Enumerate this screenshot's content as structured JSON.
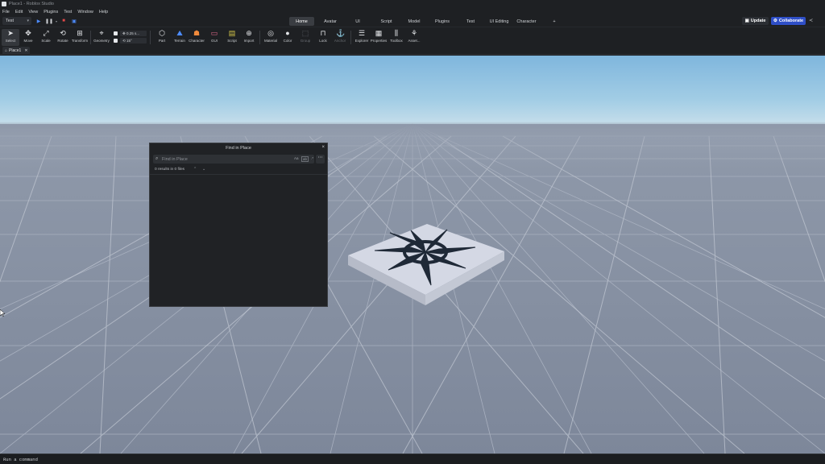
{
  "window": {
    "title": "Place1 - Roblox Studio"
  },
  "menu": [
    "File",
    "Edit",
    "View",
    "Plugins",
    "Test",
    "Window",
    "Help"
  ],
  "mode_select": {
    "value": "Test"
  },
  "ribbon_tabs": [
    "Home",
    "Avatar",
    "UI",
    "Script",
    "Model",
    "Plugins",
    "Test",
    "UI Editing",
    "Character",
    "+"
  ],
  "header_buttons": {
    "update": "Update",
    "collaborate": "Collaborate"
  },
  "tools": {
    "select": "Select",
    "move": "Move",
    "scale": "Scale",
    "rotate": "Rotate",
    "transform": "Transform",
    "geometry": "Geometry",
    "move_snap": "0.25 s...",
    "rotate_snap": "15°",
    "part": "Part",
    "terrain": "Terrain",
    "character": "Character",
    "gui": "GUI",
    "script": "Script",
    "import": "Import",
    "material": "Material",
    "color": "Color",
    "group": "Group",
    "lock": "Lock",
    "anchor": "Anchor",
    "explorer": "Explorer",
    "properties": "Properties",
    "toolbox": "Toolbox",
    "assets": "Asset..."
  },
  "doc_tab": {
    "label": "Place1"
  },
  "find_panel": {
    "title": "Find in Place",
    "search_placeholder": "Find in Place",
    "option_case": "Aa",
    "option_word": "ab",
    "option_regex": ".*",
    "results": "0 results in 0 files"
  },
  "command_bar": {
    "placeholder": "Run a command"
  },
  "colors": {
    "chrome_bg": "#1e2023",
    "collaborate_blue": "#2f4fc7",
    "sky": "#a2cde5",
    "baseplate": "#7d879a",
    "part_top": "#d4d8e4",
    "decal": "#1f2937"
  }
}
